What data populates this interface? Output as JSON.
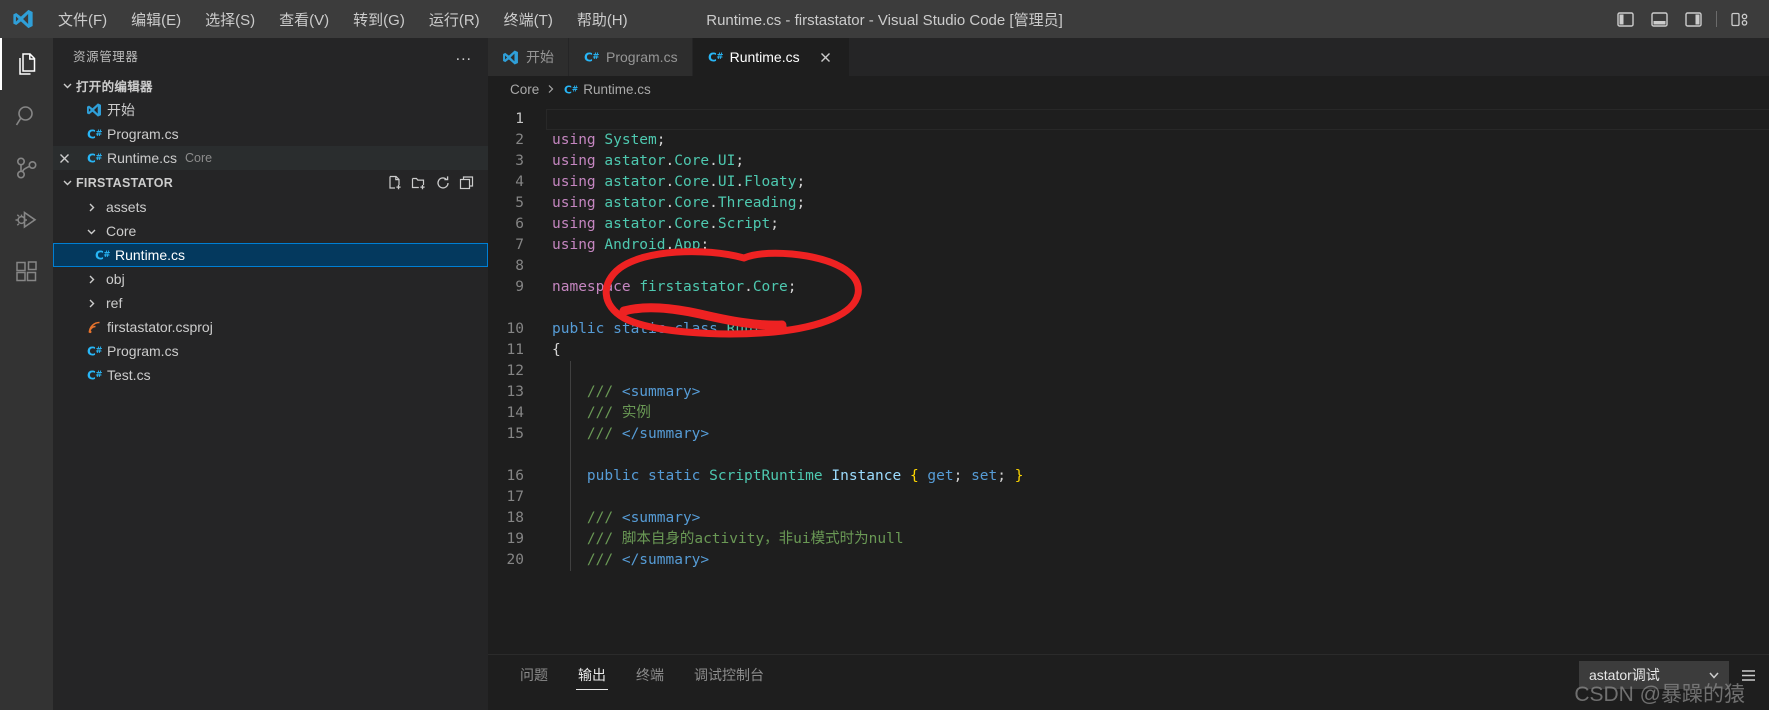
{
  "titlebar": {
    "logo_icon": "vscode-logo-icon",
    "title": "Runtime.cs - firstastator - Visual Studio Code [管理员]",
    "menus": [
      {
        "label": "文件(F)",
        "name": "menu-file"
      },
      {
        "label": "编辑(E)",
        "name": "menu-edit"
      },
      {
        "label": "选择(S)",
        "name": "menu-selection"
      },
      {
        "label": "查看(V)",
        "name": "menu-view"
      },
      {
        "label": "转到(G)",
        "name": "menu-go"
      },
      {
        "label": "运行(R)",
        "name": "menu-run"
      },
      {
        "label": "终端(T)",
        "name": "menu-terminal"
      },
      {
        "label": "帮助(H)",
        "name": "menu-help"
      }
    ],
    "layout_buttons": [
      {
        "name": "toggle-primary-sidebar-icon"
      },
      {
        "name": "toggle-panel-icon"
      },
      {
        "name": "toggle-secondary-sidebar-icon"
      },
      {
        "name": "customize-layout-icon"
      }
    ]
  },
  "activitybar": {
    "items": [
      {
        "name": "activity-explorer",
        "icon": "files-icon",
        "active": true
      },
      {
        "name": "activity-search",
        "icon": "search-icon",
        "active": false
      },
      {
        "name": "activity-source-control",
        "icon": "source-control-icon",
        "active": false
      },
      {
        "name": "activity-run-debug",
        "icon": "run-and-debug-icon",
        "active": false
      },
      {
        "name": "activity-extensions",
        "icon": "extensions-icon",
        "active": false
      }
    ]
  },
  "sidebar": {
    "title": "资源管理器",
    "more_actions": "...",
    "open_editors": {
      "header": "打开的编辑器",
      "items": [
        {
          "label": "开始",
          "icon": "vscode-logo-icon",
          "description": "",
          "state": "normal"
        },
        {
          "label": "Program.cs",
          "icon": "csharp-icon",
          "description": "",
          "state": "normal"
        },
        {
          "label": "Runtime.cs",
          "icon": "csharp-icon",
          "description": "Core",
          "state": "active"
        }
      ]
    },
    "workspace": {
      "header": "FIRSTASTATOR",
      "actions": [
        {
          "name": "new-file-icon"
        },
        {
          "name": "new-folder-icon"
        },
        {
          "name": "refresh-explorer-icon"
        },
        {
          "name": "collapse-folders-icon"
        }
      ],
      "tree": [
        {
          "label": "assets",
          "type": "folder",
          "expanded": false,
          "depth": 1,
          "selected": false
        },
        {
          "label": "Core",
          "type": "folder",
          "expanded": true,
          "depth": 1,
          "selected": false
        },
        {
          "label": "Runtime.cs",
          "type": "csharp",
          "depth": 2,
          "selected": true
        },
        {
          "label": "obj",
          "type": "folder",
          "expanded": false,
          "depth": 1,
          "selected": false
        },
        {
          "label": "ref",
          "type": "folder",
          "expanded": false,
          "depth": 1,
          "selected": false
        },
        {
          "label": "firstastator.csproj",
          "type": "csproj",
          "depth": 1,
          "selected": false
        },
        {
          "label": "Program.cs",
          "type": "csharp",
          "depth": 1,
          "selected": false
        },
        {
          "label": "Test.cs",
          "type": "csharp",
          "depth": 1,
          "selected": false
        }
      ]
    }
  },
  "editor": {
    "tabs": [
      {
        "label": "开始",
        "icon": "vscode-logo-icon",
        "active": false,
        "closable": false
      },
      {
        "label": "Program.cs",
        "icon": "csharp-icon",
        "active": false,
        "closable": false
      },
      {
        "label": "Runtime.cs",
        "icon": "csharp-icon",
        "active": true,
        "closable": true
      }
    ],
    "breadcrumb": [
      {
        "label": "Core",
        "icon": ""
      },
      {
        "label": "Runtime.cs",
        "icon": "csharp-icon"
      }
    ],
    "cursor_line": 1,
    "lines": [
      {
        "n": "1",
        "blank": true,
        "current": true,
        "tokens": []
      },
      {
        "n": "2",
        "tokens": [
          {
            "t": "using ",
            "c": "ctl"
          },
          {
            "t": "System",
            "c": "ns"
          },
          {
            "t": ";",
            "c": "pn"
          }
        ]
      },
      {
        "n": "3",
        "tokens": [
          {
            "t": "using ",
            "c": "ctl"
          },
          {
            "t": "astator",
            "c": "ns"
          },
          {
            "t": ".",
            "c": "pn"
          },
          {
            "t": "Core",
            "c": "ns"
          },
          {
            "t": ".",
            "c": "pn"
          },
          {
            "t": "UI",
            "c": "ns"
          },
          {
            "t": ";",
            "c": "pn"
          }
        ]
      },
      {
        "n": "4",
        "tokens": [
          {
            "t": "using ",
            "c": "ctl"
          },
          {
            "t": "astator",
            "c": "ns"
          },
          {
            "t": ".",
            "c": "pn"
          },
          {
            "t": "Core",
            "c": "ns"
          },
          {
            "t": ".",
            "c": "pn"
          },
          {
            "t": "UI",
            "c": "ns"
          },
          {
            "t": ".",
            "c": "pn"
          },
          {
            "t": "Floaty",
            "c": "ns"
          },
          {
            "t": ";",
            "c": "pn"
          }
        ]
      },
      {
        "n": "5",
        "tokens": [
          {
            "t": "using ",
            "c": "ctl"
          },
          {
            "t": "astator",
            "c": "ns"
          },
          {
            "t": ".",
            "c": "pn"
          },
          {
            "t": "Core",
            "c": "ns"
          },
          {
            "t": ".",
            "c": "pn"
          },
          {
            "t": "Threading",
            "c": "ns"
          },
          {
            "t": ";",
            "c": "pn"
          }
        ]
      },
      {
        "n": "6",
        "tokens": [
          {
            "t": "using ",
            "c": "ctl"
          },
          {
            "t": "astator",
            "c": "ns"
          },
          {
            "t": ".",
            "c": "pn"
          },
          {
            "t": "Core",
            "c": "ns"
          },
          {
            "t": ".",
            "c": "pn"
          },
          {
            "t": "Script",
            "c": "ns"
          },
          {
            "t": ";",
            "c": "pn"
          }
        ]
      },
      {
        "n": "7",
        "tokens": [
          {
            "t": "using ",
            "c": "ctl"
          },
          {
            "t": "Android",
            "c": "ns"
          },
          {
            "t": ".",
            "c": "pn"
          },
          {
            "t": "App",
            "c": "ns"
          },
          {
            "t": ";",
            "c": "pn"
          }
        ]
      },
      {
        "n": "8",
        "blank": true,
        "tokens": []
      },
      {
        "n": "9",
        "tokens": [
          {
            "t": "namespace ",
            "c": "ctl"
          },
          {
            "t": "firstastator",
            "c": "ns"
          },
          {
            "t": ".",
            "c": "pn"
          },
          {
            "t": "Core",
            "c": "ns"
          },
          {
            "t": ";",
            "c": "pn"
          }
        ]
      },
      {
        "n": "",
        "blank": true,
        "tokens": []
      },
      {
        "n": "10",
        "tokens": [
          {
            "t": "public ",
            "c": "kw"
          },
          {
            "t": "static ",
            "c": "kw"
          },
          {
            "t": "class ",
            "c": "kw"
          },
          {
            "t": "Runtime",
            "c": "type"
          }
        ]
      },
      {
        "n": "11",
        "tokens": [
          {
            "t": "{",
            "c": "pn"
          }
        ]
      },
      {
        "n": "12",
        "blank": true,
        "guide": true,
        "tokens": []
      },
      {
        "n": "13",
        "guide": true,
        "tokens": [
          {
            "t": "    ",
            "c": "pn"
          },
          {
            "t": "/// ",
            "c": "cmt"
          },
          {
            "t": "<summary>",
            "c": "xml"
          }
        ]
      },
      {
        "n": "14",
        "guide": true,
        "tokens": [
          {
            "t": "    ",
            "c": "pn"
          },
          {
            "t": "/// ",
            "c": "cmt"
          },
          {
            "t": "实例",
            "c": "cmt"
          }
        ]
      },
      {
        "n": "15",
        "guide": true,
        "tokens": [
          {
            "t": "    ",
            "c": "pn"
          },
          {
            "t": "/// ",
            "c": "cmt"
          },
          {
            "t": "</summary>",
            "c": "xml"
          }
        ]
      },
      {
        "n": "",
        "blank": true,
        "guide": true,
        "tokens": []
      },
      {
        "n": "16",
        "guide": true,
        "tokens": [
          {
            "t": "    ",
            "c": "pn"
          },
          {
            "t": "public ",
            "c": "kw"
          },
          {
            "t": "static ",
            "c": "kw"
          },
          {
            "t": "ScriptRuntime ",
            "c": "type"
          },
          {
            "t": "Instance ",
            "c": "var"
          },
          {
            "t": "{ ",
            "c": "br1"
          },
          {
            "t": "get",
            "c": "kw"
          },
          {
            "t": "; ",
            "c": "pn"
          },
          {
            "t": "set",
            "c": "kw"
          },
          {
            "t": "; ",
            "c": "pn"
          },
          {
            "t": "}",
            "c": "br1"
          }
        ]
      },
      {
        "n": "17",
        "blank": true,
        "guide": true,
        "tokens": []
      },
      {
        "n": "18",
        "guide": true,
        "tokens": [
          {
            "t": "    ",
            "c": "pn"
          },
          {
            "t": "/// ",
            "c": "cmt"
          },
          {
            "t": "<summary>",
            "c": "xml"
          }
        ]
      },
      {
        "n": "19",
        "guide": true,
        "tokens": [
          {
            "t": "    ",
            "c": "pn"
          },
          {
            "t": "/// ",
            "c": "cmt"
          },
          {
            "t": "脚本自身的activity，非ui模式时为null",
            "c": "cmt"
          }
        ]
      },
      {
        "n": "20",
        "guide": true,
        "tokens": [
          {
            "t": "    ",
            "c": "pn"
          },
          {
            "t": "/// ",
            "c": "cmt"
          },
          {
            "t": "</summary>",
            "c": "xml"
          }
        ]
      }
    ],
    "annotation": {
      "name": "red-circle-annotation",
      "color": "#ee2222",
      "target_text": "firstastator.Core;"
    }
  },
  "panel": {
    "tabs": [
      {
        "label": "问题",
        "active": false,
        "name": "panel-tab-problems"
      },
      {
        "label": "输出",
        "active": true,
        "name": "panel-tab-output"
      },
      {
        "label": "终端",
        "active": false,
        "name": "panel-tab-terminal"
      },
      {
        "label": "调试控制台",
        "active": false,
        "name": "panel-tab-debug-console"
      }
    ],
    "output_channel": "astator调试",
    "chevron_icon": "chevron-down-icon",
    "more_icon": "panel-views-icon"
  },
  "watermark": "CSDN @暴躁的猿",
  "colors": {
    "titlebar_bg": "#3c3c3c",
    "activitybar_bg": "#333333",
    "sidebar_bg": "#252526",
    "editor_bg": "#1e1e1e",
    "tab_inactive_bg": "#2d2d2d",
    "selection_blue": "#04395e",
    "selection_border": "#007fd4",
    "csharp_icon": "#28b6f6",
    "annotation_red": "#ee2222"
  }
}
